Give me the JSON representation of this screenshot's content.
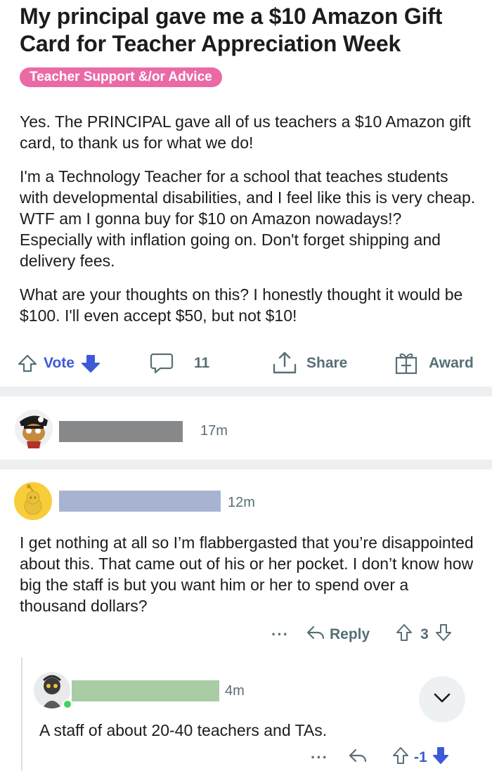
{
  "post": {
    "title": "My principal gave me a $10 Amazon Gift Card for Teacher Appreciation Week",
    "flair": "Teacher Support &/or Advice",
    "body": [
      "Yes. The PRINCIPAL gave all of us teachers a $10 Amazon gift card, to thank us for what we do!",
      "I'm a Technology Teacher for a school that teaches students with developmental disabilities, and I feel like this is very cheap. WTF am I gonna buy for $10 on Amazon nowadays!? Especially with inflation going on. Don't forget shipping and delivery fees.",
      "What are your thoughts on this? I honestly thought it would be $100. I'll even accept $50, but not $10!"
    ],
    "actions": {
      "vote_label": "Vote",
      "comment_count": "11",
      "share_label": "Share",
      "award_label": "Award"
    }
  },
  "comments": [
    {
      "time": "17m",
      "username_redaction_color": "#86888a",
      "text": ""
    },
    {
      "time": "12m",
      "username_redaction_color": "#a8b3d1",
      "text": "I get nothing at all so I’m flabbergasted that you’re disappointed about this. That came out of his or her pocket. I don’t know how big the staff is but you want him or her to spend over a thousand dollars?",
      "more": "···",
      "reply_label": "Reply",
      "score": "3"
    },
    {
      "time": "4m",
      "username_redaction_color": "#a9cca4",
      "text": "A staff of about 20-40 teachers and TAs.",
      "more": "···",
      "score": "-1"
    }
  ],
  "colors": {
    "flair": "#ea6aa6",
    "upvote_accent": "#3d5ad6",
    "muted_text": "#576f76",
    "divider": "#edeff1",
    "online": "#46d160"
  },
  "icons": [
    "upvote-icon",
    "downvote-icon",
    "comment-icon",
    "share-icon",
    "award-icon",
    "reply-icon",
    "chevron-down-icon"
  ]
}
